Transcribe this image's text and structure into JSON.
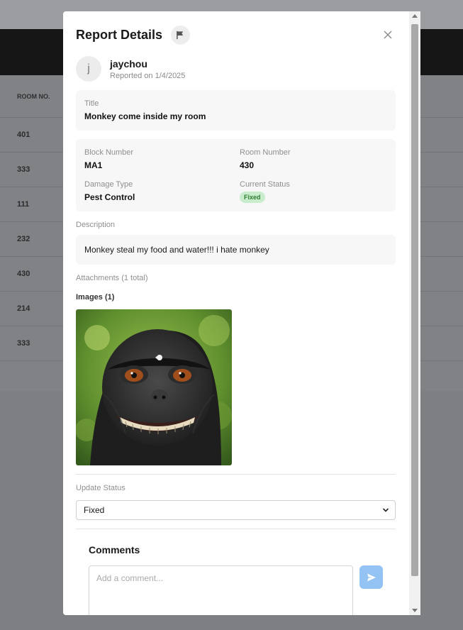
{
  "background": {
    "table_header": "ROOM NO.",
    "rooms": [
      "401",
      "333",
      "111",
      "232",
      "430",
      "214",
      "333"
    ]
  },
  "modal": {
    "title": "Report Details",
    "flag_icon": "flag-icon",
    "close_icon": "close-icon",
    "reporter": {
      "initial": "j",
      "name": "jaychou",
      "reported_on": "Reported on 1/4/2025"
    },
    "title_card": {
      "label": "Title",
      "value": "Monkey come inside my room"
    },
    "details": {
      "block_label": "Block Number",
      "block_value": "MA1",
      "room_label": "Room Number",
      "room_value": "430",
      "damage_label": "Damage Type",
      "damage_value": "Pest Control",
      "status_label": "Current Status",
      "status_value": "Fixed"
    },
    "description": {
      "label": "Description",
      "text": "Monkey steal my food and water!!! i hate monkey"
    },
    "attachments": {
      "label": "Attachments (1 total)",
      "images_label": "Images (1)"
    },
    "update_status": {
      "label": "Update Status",
      "selected": "Fixed"
    },
    "comments": {
      "title": "Comments",
      "placeholder": "Add a comment..."
    }
  },
  "colors": {
    "status_badge_bg": "#c9eccd",
    "status_badge_text": "#2e7d32",
    "send_button": "#92c3f2"
  }
}
